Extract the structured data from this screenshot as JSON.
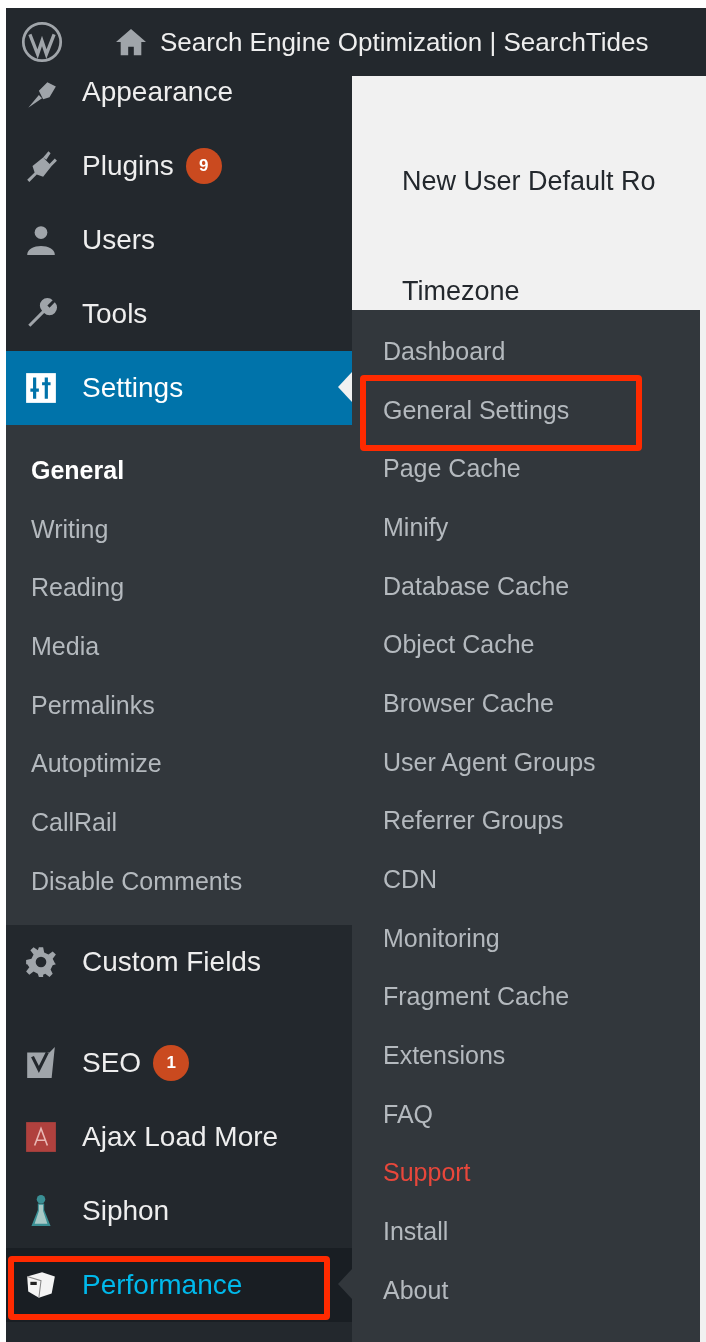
{
  "top_bar": {
    "site_title": "Search Engine Optimization | SearchTides"
  },
  "sidebar": {
    "groups": [
      {
        "items": [
          {
            "label": "Appearance",
            "selected": false,
            "flyout_open": false,
            "annotated": false
          },
          {
            "label": "Plugins",
            "badge": "9",
            "selected": false,
            "flyout_open": false,
            "annotated": false
          },
          {
            "label": "Users",
            "selected": false,
            "flyout_open": false,
            "annotated": false
          },
          {
            "label": "Tools",
            "selected": false,
            "flyout_open": false,
            "annotated": false
          },
          {
            "label": "Settings",
            "selected": true,
            "flyout_open": false,
            "annotated": false,
            "submenu": [
              {
                "label": "General",
                "selected": true
              },
              {
                "label": "Writing",
                "selected": false
              },
              {
                "label": "Reading",
                "selected": false
              },
              {
                "label": "Media",
                "selected": false
              },
              {
                "label": "Permalinks",
                "selected": false
              },
              {
                "label": "Autoptimize",
                "selected": false
              },
              {
                "label": "CallRail",
                "selected": false
              },
              {
                "label": "Disable Comments",
                "selected": false
              }
            ]
          }
        ]
      },
      {
        "items": [
          {
            "label": "Custom Fields",
            "selected": false,
            "flyout_open": false,
            "annotated": false
          }
        ]
      },
      {
        "items": [
          {
            "label": "SEO",
            "badge": "1",
            "selected": false,
            "flyout_open": false,
            "annotated": false
          },
          {
            "label": "Ajax Load More",
            "selected": false,
            "flyout_open": false,
            "annotated": false
          },
          {
            "label": "Siphon",
            "selected": false,
            "flyout_open": false,
            "annotated": false
          },
          {
            "label": "Performance",
            "selected": false,
            "flyout_open": true,
            "annotated": true
          }
        ]
      }
    ]
  },
  "content": {
    "field_labels": [
      "New User Default Ro",
      "Timezone"
    ]
  },
  "flyout": {
    "items": [
      {
        "label": "Dashboard",
        "emphasized": false,
        "annotated": false
      },
      {
        "label": "General Settings",
        "emphasized": false,
        "annotated": true
      },
      {
        "label": "Page Cache",
        "emphasized": false,
        "annotated": false
      },
      {
        "label": "Minify",
        "emphasized": false,
        "annotated": false
      },
      {
        "label": "Database Cache",
        "emphasized": false,
        "annotated": false
      },
      {
        "label": "Object Cache",
        "emphasized": false,
        "annotated": false
      },
      {
        "label": "Browser Cache",
        "emphasized": false,
        "annotated": false
      },
      {
        "label": "User Agent Groups",
        "emphasized": false,
        "annotated": false
      },
      {
        "label": "Referrer Groups",
        "emphasized": false,
        "annotated": false
      },
      {
        "label": "CDN",
        "emphasized": false,
        "annotated": false
      },
      {
        "label": "Monitoring",
        "emphasized": false,
        "annotated": false
      },
      {
        "label": "Fragment Cache",
        "emphasized": false,
        "annotated": false
      },
      {
        "label": "Extensions",
        "emphasized": false,
        "annotated": false
      },
      {
        "label": "FAQ",
        "emphasized": false,
        "annotated": false
      },
      {
        "label": "Support",
        "emphasized": true,
        "annotated": false
      },
      {
        "label": "Install",
        "emphasized": false,
        "annotated": false
      },
      {
        "label": "About",
        "emphasized": false,
        "annotated": false
      }
    ]
  }
}
